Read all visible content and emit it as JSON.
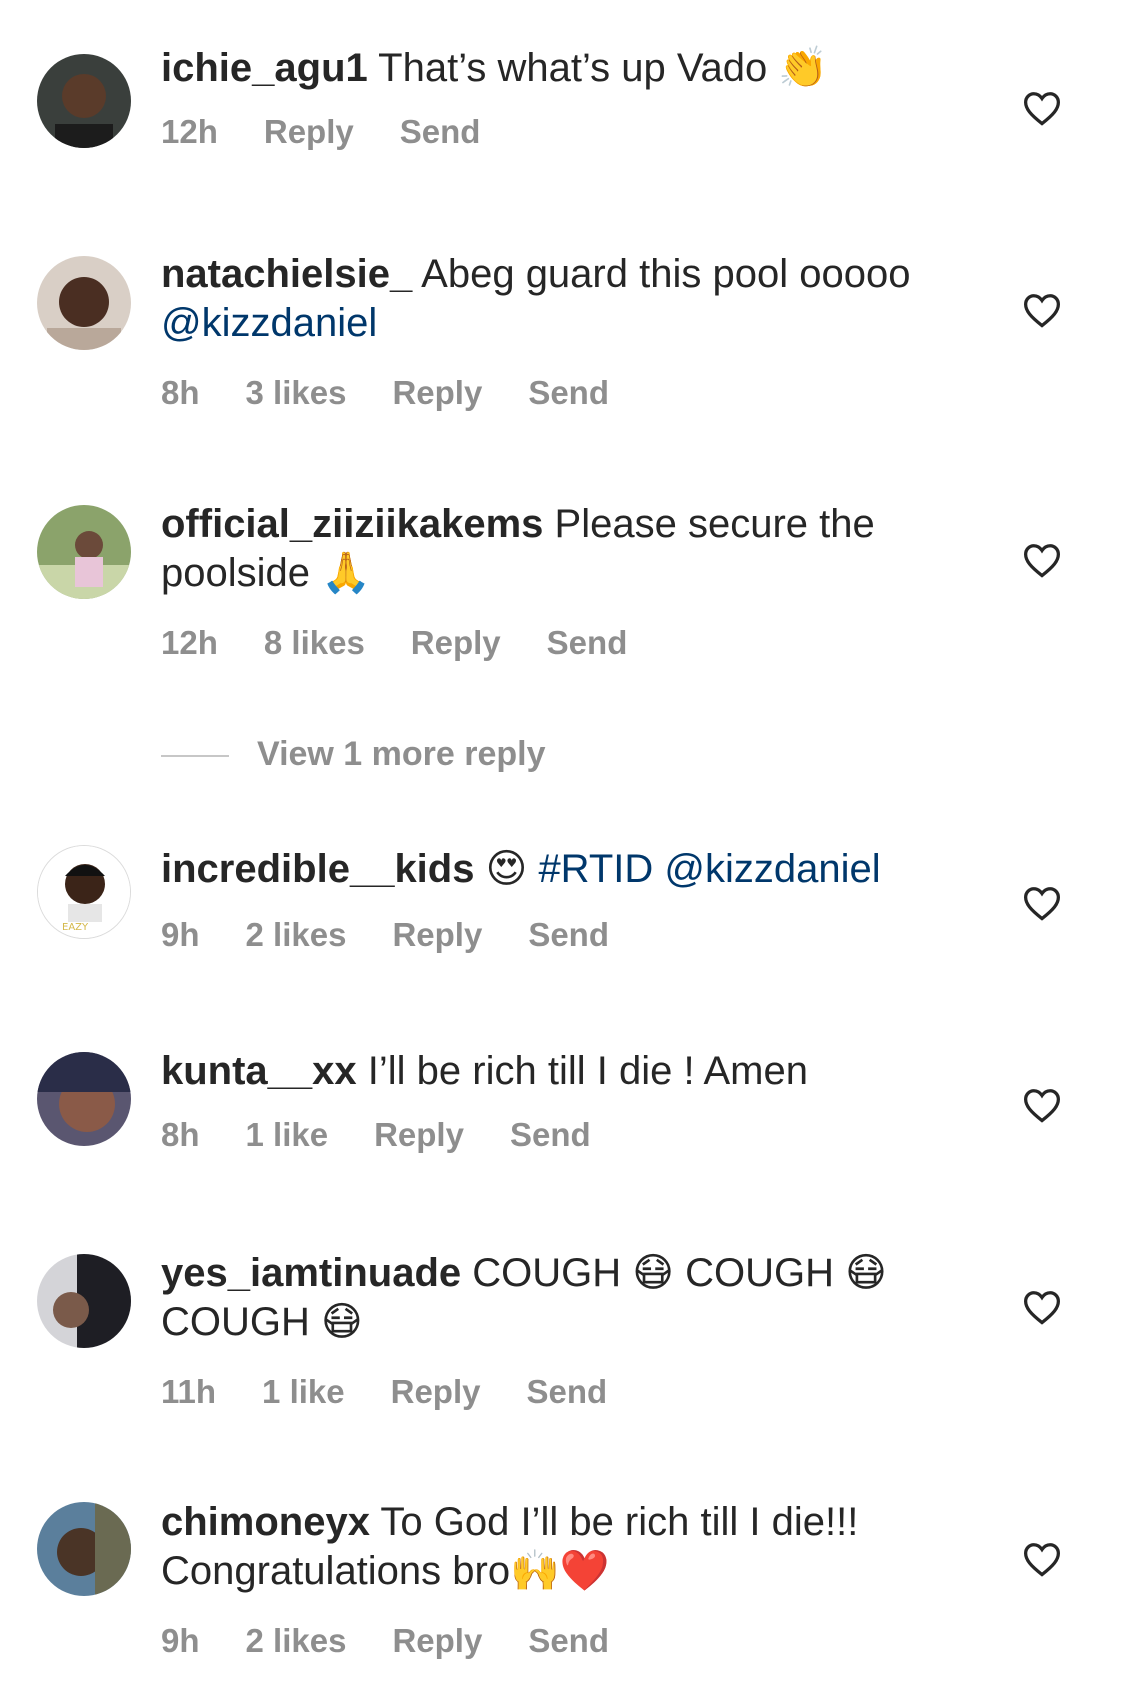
{
  "colors": {
    "text": "#262626",
    "meta": "#8e8e8e",
    "mention": "#00376b",
    "heart_red": "#ed4956"
  },
  "comments": [
    {
      "user": "ichie_agu1",
      "text": "That’s what’s up Vado",
      "emoji": "👏",
      "time": "12h",
      "likes": "",
      "reply": "Reply",
      "send": "Send"
    },
    {
      "user": "natachielsie_",
      "text": "Abeg guard this pool ooooo",
      "mention": "@kizzdaniel",
      "time": "8h",
      "likes": "3 likes",
      "reply": "Reply",
      "send": "Send"
    },
    {
      "user": "official_ziiziikakems",
      "text": "Please secure the poolside",
      "emoji": "🙏",
      "time": "12h",
      "likes": "8 likes",
      "reply": "Reply",
      "send": "Send"
    },
    {
      "user": "incredible__kids",
      "emoji": "😍",
      "mention": "#RTID @kizzdaniel",
      "time": "9h",
      "likes": "2 likes",
      "reply": "Reply",
      "send": "Send"
    },
    {
      "user": "kunta__xx",
      "text": "I’ll be rich till I die ! Amen",
      "time": "8h",
      "likes": "1 like",
      "reply": "Reply",
      "send": "Send"
    },
    {
      "user": "yes_iamtinuade",
      "text1": "COUGH",
      "text2": "COUGH",
      "text3": "COUGH",
      "emoji": "😷",
      "time": "11h",
      "likes": "1 like",
      "reply": "Reply",
      "send": "Send"
    },
    {
      "user": "chimoneyx",
      "text": "To God I’ll be rich till I die!!! Congratulations bro",
      "emoji1": "🙌",
      "emoji2": "❤️",
      "time": "9h",
      "likes": "2 likes",
      "reply": "Reply",
      "send": "Send"
    }
  ],
  "view_more": "View 1 more reply",
  "icons": {
    "heart": "heart-outline-icon"
  }
}
